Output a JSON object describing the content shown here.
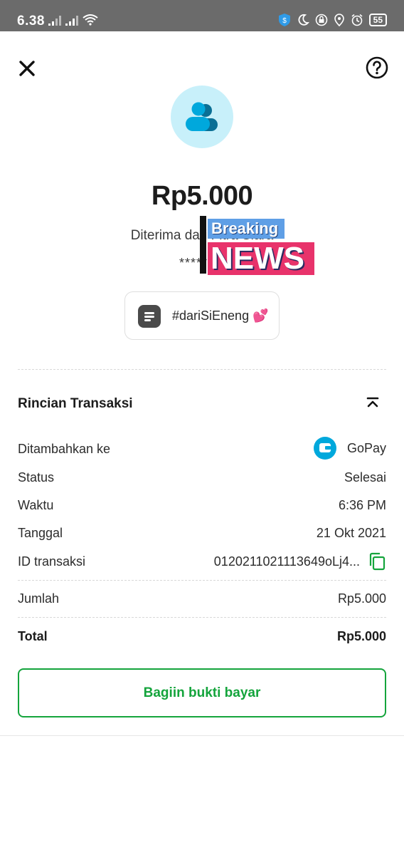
{
  "status_bar": {
    "time": "6.38",
    "battery": "55"
  },
  "header": {
    "close_icon": "close-icon",
    "help_icon": "help-icon"
  },
  "summary": {
    "amount": "Rp5.000",
    "received_from": "Diterima dari Fitra Siara",
    "masked_account": "********",
    "message": "#dariSiEneng 💕"
  },
  "sticker": {
    "breaking": "Breaking",
    "news": "NEWS"
  },
  "details": {
    "title": "Rincian Transaksi",
    "rows": [
      {
        "label": "Ditambahkan ke",
        "value": "GoPay"
      },
      {
        "label": "Status",
        "value": "Selesai"
      },
      {
        "label": "Waktu",
        "value": "6:36 PM"
      },
      {
        "label": "Tanggal",
        "value": "21 Okt 2021"
      },
      {
        "label": "ID transaksi",
        "value": "0120211021113649oLj4..."
      }
    ],
    "jumlah_label": "Jumlah",
    "jumlah_value": "Rp5.000",
    "total_label": "Total",
    "total_value": "Rp5.000"
  },
  "actions": {
    "share_label": "Bagiin bukti bayar"
  },
  "colors": {
    "accent_green": "#14a43c",
    "gopay_blue": "#00a8dc",
    "avatar_bg": "#c8f0fa"
  }
}
